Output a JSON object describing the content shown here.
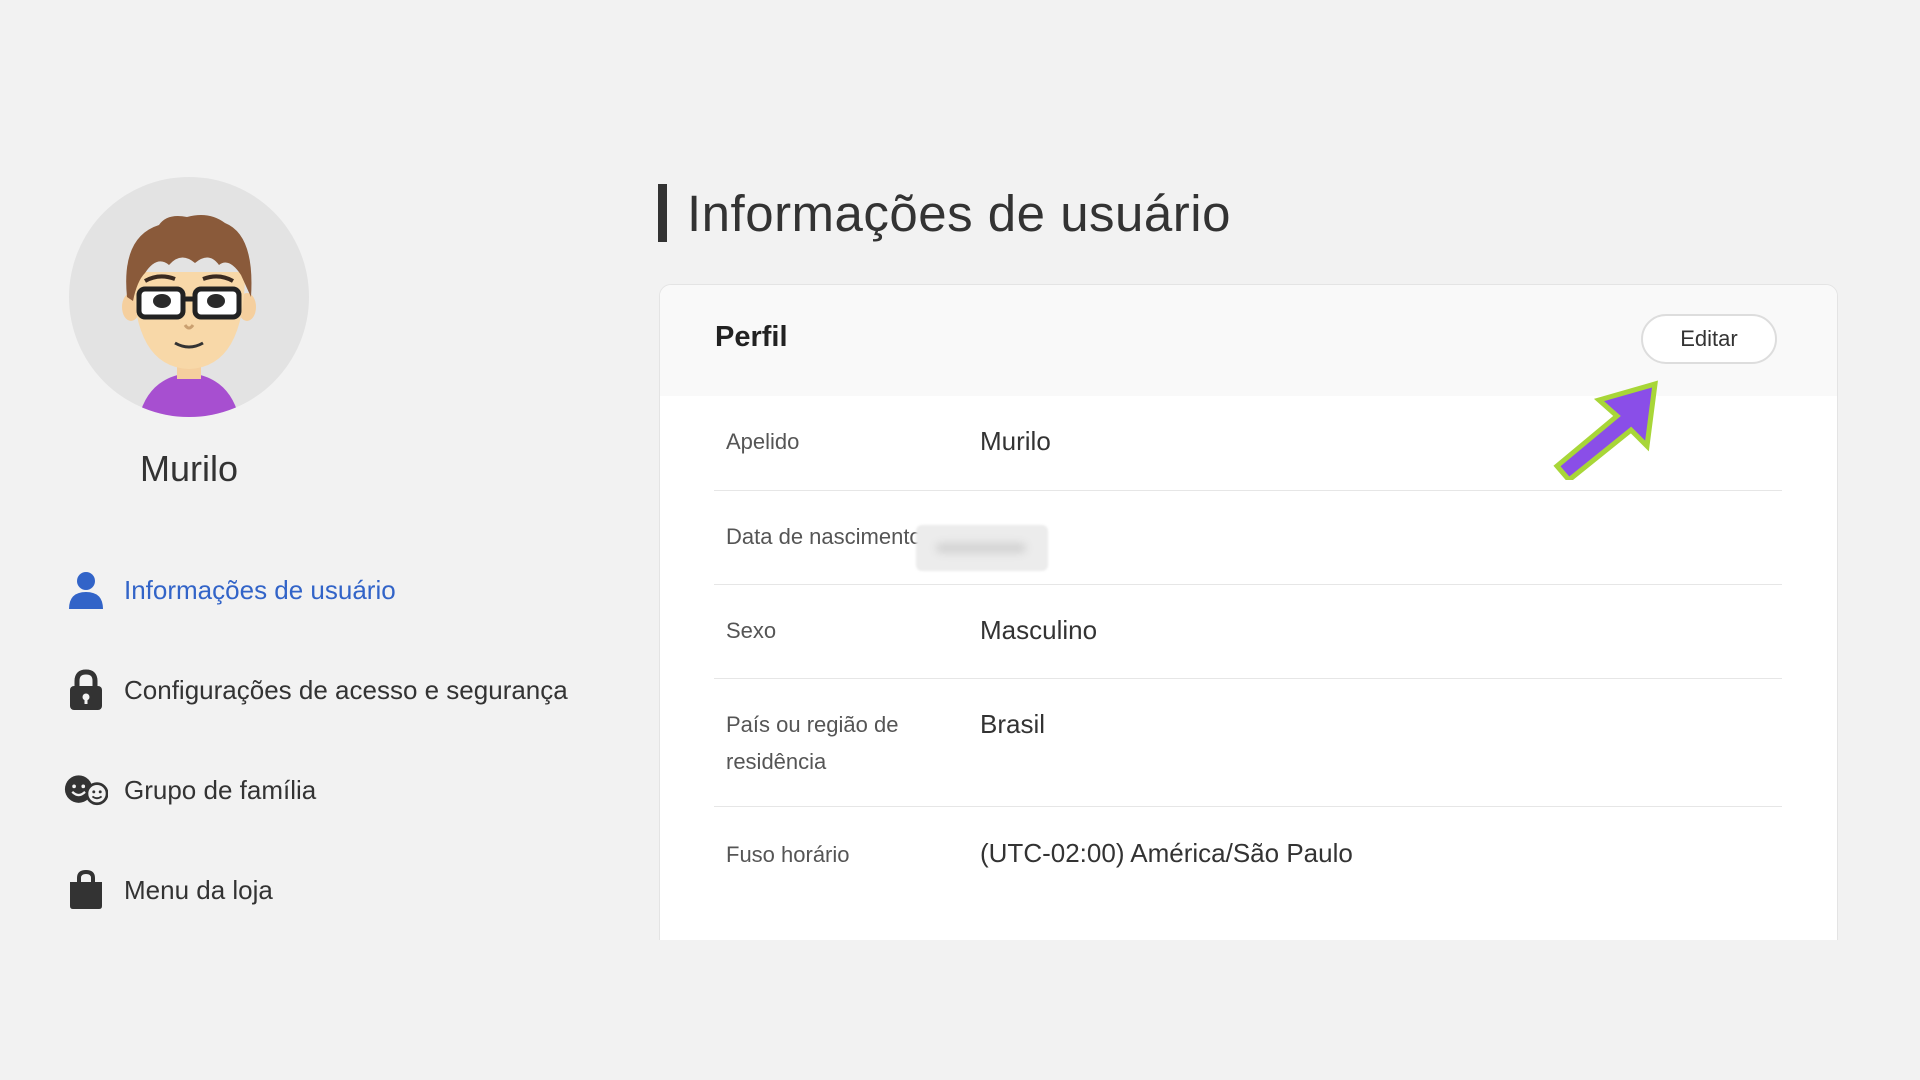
{
  "sidebar": {
    "username": "Murilo",
    "nav": [
      {
        "label": "Informações de usuário",
        "icon": "person-icon",
        "active": true
      },
      {
        "label": "Configurações de acesso e segurança",
        "icon": "lock-icon",
        "active": false
      },
      {
        "label": "Grupo de família",
        "icon": "family-icon",
        "active": false
      },
      {
        "label": "Menu da loja",
        "icon": "shopping-bag-icon",
        "active": false
      }
    ]
  },
  "main": {
    "title": "Informações de usuário",
    "card": {
      "title": "Perfil",
      "edit_label": "Editar",
      "rows": [
        {
          "label": "Apelido",
          "value": "Murilo"
        },
        {
          "label": "Data de nascimento",
          "value": ""
        },
        {
          "label": "Sexo",
          "value": "Masculino"
        },
        {
          "label": "País ou região de residência",
          "value": "Brasil"
        },
        {
          "label": "Fuso horário",
          "value": "(UTC-02:00) América/São Paulo"
        }
      ]
    }
  },
  "colors": {
    "accent": "#3264c8",
    "arrow_fill": "#8a4ee8",
    "arrow_outline": "#a8d638",
    "avatar_shirt": "#a74fd0"
  }
}
